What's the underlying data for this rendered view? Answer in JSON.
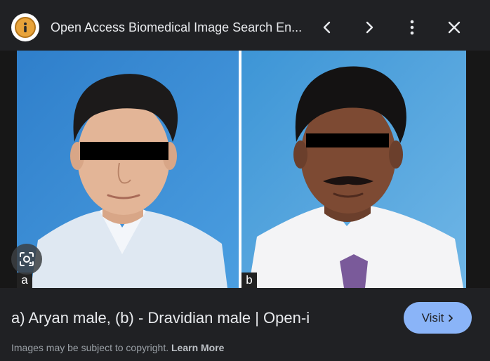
{
  "header": {
    "site_icon": "info-icon",
    "title": "Open Access Biomedical Image Search En...",
    "prev_icon": "chevron-left-icon",
    "next_icon": "chevron-right-icon",
    "more_icon": "more-vert-icon",
    "close_icon": "close-icon"
  },
  "image": {
    "panels": [
      {
        "label": "a"
      },
      {
        "label": "b"
      }
    ],
    "lens_icon": "lens-icon"
  },
  "caption": "a) Aryan male, (b) - Dravidian male | Open-i",
  "visit": {
    "label": "Visit",
    "icon": "chevron-right-icon"
  },
  "footer": {
    "copyright": "Images may be subject to copyright.",
    "learn_more": "Learn More"
  },
  "colors": {
    "background": "#202124",
    "accent": "#8ab4f8",
    "text": "#e8eaed",
    "muted": "#9aa0a6"
  }
}
